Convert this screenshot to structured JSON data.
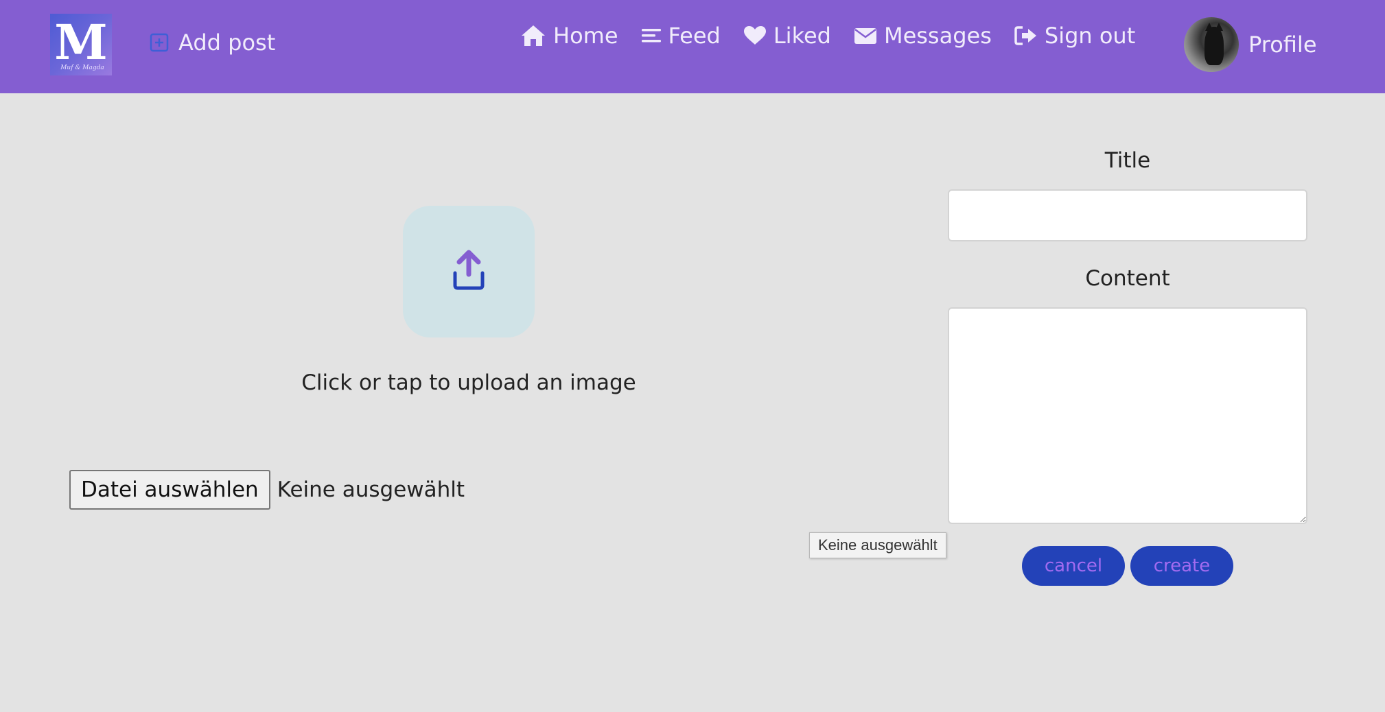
{
  "header": {
    "logo": {
      "letter": "M",
      "tagline": "Muf & Magda"
    },
    "add_post_label": "Add post",
    "nav": [
      {
        "label": "Home",
        "icon": "home-icon"
      },
      {
        "label": "Feed",
        "icon": "menu-icon"
      },
      {
        "label": "Liked",
        "icon": "heart-icon"
      },
      {
        "label": "Messages",
        "icon": "envelope-icon"
      },
      {
        "label": "Sign out",
        "icon": "sign-out-icon"
      }
    ],
    "profile_label": "Profile"
  },
  "upload": {
    "hint": "Click or tap to upload an image",
    "file_button": "Datei auswählen",
    "file_status": "Keine ausgewählt",
    "tooltip": "Keine ausgewählt"
  },
  "form": {
    "title_label": "Title",
    "title_value": "",
    "content_label": "Content",
    "content_value": "",
    "cancel_label": "cancel",
    "create_label": "create"
  },
  "colors": {
    "navbar": "#845ed1",
    "background": "#e3e3e3",
    "button_bg": "#2342b8",
    "button_text": "#a26bf0",
    "upload_tile": "#d0e3e7"
  }
}
